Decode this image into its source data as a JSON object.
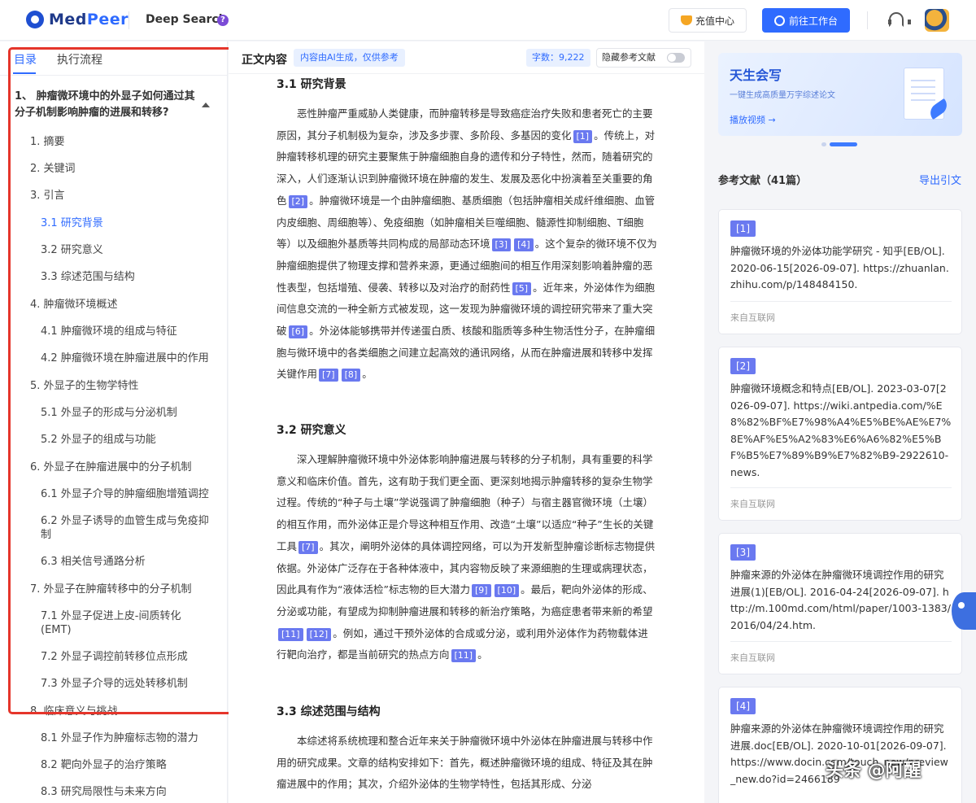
{
  "header": {
    "logo_main": "Med",
    "logo_accent": "Peer",
    "product": "Deep Search",
    "help_mark": "?",
    "recharge_label": "充值中心",
    "workspace_label": "前往工作台"
  },
  "toc": {
    "tabs": [
      "目录",
      "执行流程"
    ],
    "title": "1、 肿瘤微环境中的外显子如何通过其分子机制影响肿瘤的进展和转移?",
    "items": [
      {
        "text": "1. 摘要"
      },
      {
        "text": "2. 关键词"
      },
      {
        "text": "3. 引言"
      },
      {
        "text": "3.1 研究背景"
      },
      {
        "text": "3.2 研究意义"
      },
      {
        "text": "3.3 综述范围与结构"
      },
      {
        "text": "4. 肿瘤微环境概述"
      },
      {
        "text": "4.1 肿瘤微环境的组成与特征"
      },
      {
        "text": "4.2 肿瘤微环境在肿瘤进展中的作用"
      },
      {
        "text": "5. 外显子的生物学特性"
      },
      {
        "text": "5.1 外显子的形成与分泌机制"
      },
      {
        "text": "5.2 外显子的组成与功能"
      },
      {
        "text": "6. 外显子在肿瘤进展中的分子机制"
      },
      {
        "text": "6.1 外显子介导的肿瘤细胞增殖调控"
      },
      {
        "text": "6.2 外显子诱导的血管生成与免疫抑制"
      },
      {
        "text": "6.3 相关信号通路分析"
      },
      {
        "text": "7. 外显子在肿瘤转移中的分子机制"
      },
      {
        "text": "7.1 外显子促进上皮-间质转化(EMT)"
      },
      {
        "text": "7.2 外显子调控前转移位点形成"
      },
      {
        "text": "7.3 外显子介导的远处转移机制"
      },
      {
        "text": "8. 临床意义与挑战"
      },
      {
        "text": "8.1 外显子作为肿瘤标志物的潜力"
      },
      {
        "text": "8.2 靶向外显子的治疗策略"
      },
      {
        "text": "8.3 研究局限性与未来方向"
      }
    ]
  },
  "main": {
    "title": "正文内容",
    "ai_tag": "内容由AI生成，仅供参考",
    "word_count": "字数：9,222",
    "hide_refs_label": "隐藏参考文献",
    "sections": [
      {
        "heading": "3.1 研究背景",
        "segments": [
          {
            "t": "恶性肿瘤严重威胁人类健康，而肿瘤转移是导致癌症治疗失败和患者死亡的主要原因，其分子机制极为复杂，涉及多步骤、多阶段、多基因的变化"
          },
          {
            "c": "[1]"
          },
          {
            "t": "。传统上，对肿瘤转移机理的研究主要聚焦于肿瘤细胞自身的遗传和分子特性，然而，随着研究的深入，人们逐渐认识到肿瘤微环境在肿瘤的发生、发展及恶化中扮演着至关重要的角色"
          },
          {
            "c": "[2]"
          },
          {
            "t": "。肿瘤微环境是一个由肿瘤细胞、基质细胞（包括肿瘤相关成纤维细胞、血管内皮细胞、周细胞等）、免疫细胞（如肿瘤相关巨噬细胞、髓源性抑制细胞、T细胞等）以及细胞外基质等共同构成的局部动态环境"
          },
          {
            "c": "[3]"
          },
          {
            "c": "[4]"
          },
          {
            "t": "。这个复杂的微环境不仅为肿瘤细胞提供了物理支撑和营养来源，更通过细胞间的相互作用深刻影响着肿瘤的恶性表型，包括增殖、侵袭、转移以及对治疗的耐药性"
          },
          {
            "c": "[5]"
          },
          {
            "t": "。近年来，外泌体作为细胞间信息交流的一种全新方式被发现，这一发现为肿瘤微环境的调控研究带来了重大突破"
          },
          {
            "c": "[6]"
          },
          {
            "t": "。外泌体能够携带并传递蛋白质、核酸和脂质等多种生物活性分子，在肿瘤细胞与微环境中的各类细胞之间建立起高效的通讯网络，从而在肿瘤进展和转移中发挥关键作用"
          },
          {
            "c": "[7]"
          },
          {
            "c": "[8]"
          },
          {
            "t": "。"
          }
        ]
      },
      {
        "heading": "3.2 研究意义",
        "segments": [
          {
            "t": "深入理解肿瘤微环境中外泌体影响肿瘤进展与转移的分子机制，具有重要的科学意义和临床价值。首先，这有助于我们更全面、更深刻地揭示肿瘤转移的复杂生物学过程。传统的“种子与土壤”学说强调了肿瘤细胞（种子）与宿主器官微环境（土壤）的相互作用，而外泌体正是介导这种相互作用、改造“土壤”以适应“种子”生长的关键工具"
          },
          {
            "c": "[7]"
          },
          {
            "t": "。其次，阐明外泌体的具体调控网络，可以为开发新型肿瘤诊断标志物提供依据。外泌体广泛存在于各种体液中，其内容物反映了来源细胞的生理或病理状态，因此具有作为“液体活检”标志物的巨大潜力"
          },
          {
            "c": "[9]"
          },
          {
            "c": "[10]"
          },
          {
            "t": "。最后，靶向外泌体的形成、分泌或功能，有望成为抑制肿瘤进展和转移的新治疗策略，为癌症患者带来新的希望"
          },
          {
            "c": "[11]"
          },
          {
            "c": "[12]"
          },
          {
            "t": "。例如，通过干预外泌体的合成或分泌，或利用外泌体作为药物载体进行靶向治疗，都是当前研究的热点方向"
          },
          {
            "c": "[11]"
          },
          {
            "t": "。"
          }
        ]
      },
      {
        "heading": "3.3 综述范围与结构",
        "segments": [
          {
            "t": "本综述将系统梳理和整合近年来关于肿瘤微环境中外泌体在肿瘤进展与转移中作用的研究成果。文章的结构安排如下：首先，概述肿瘤微环境的组成、特征及其在肿瘤进展中的作用；其次，介绍外泌体的生物学特性，包括其形成、分泌"
          }
        ]
      }
    ]
  },
  "banner": {
    "title": "天生会写",
    "subtitle": "一键生成高质量万字综述论文",
    "link": "播放视频 →"
  },
  "refs": {
    "heading": "参考文献（41篇）",
    "export_label": "导出引文",
    "items": [
      {
        "num": "[1]",
        "text": "肿瘤微环境的外泌体功能学研究 - 知乎[EB/OL]. 2020-06-15[2026-09-07]. https://zhuanlan.zhihu.com/p/148484150.",
        "source": "来自互联网"
      },
      {
        "num": "[2]",
        "text": "肿瘤微环境概念和特点[EB/OL]. 2023-03-07[2026-09-07]. https://wiki.antpedia.com/%E8%82%BF%E7%98%A4%E5%BE%AE%E7%8E%AF%E5%A2%83%E6%A6%82%E5%BF%B5%E7%89%B9%E7%82%B9-2922610-news.",
        "source": "来自互联网"
      },
      {
        "num": "[3]",
        "text": "肿瘤来源的外泌体在肿瘤微环境调控作用的研究进展(1)[EB/OL]. 2016-04-24[2026-09-07]. http://m.100md.com/html/paper/1003-1383/2016/04/24.htm.",
        "source": "来自互联网"
      },
      {
        "num": "[4]",
        "text": "肿瘤来源的外泌体在肿瘤微环境调控作用的研究进展.doc[EB/OL]. 2020-10-01[2026-09-07]. https://www.docin.com/touch_new/preview_new.do?id=2466189",
        "source": ""
      }
    ]
  },
  "watermark": "头条 @阿醒"
}
